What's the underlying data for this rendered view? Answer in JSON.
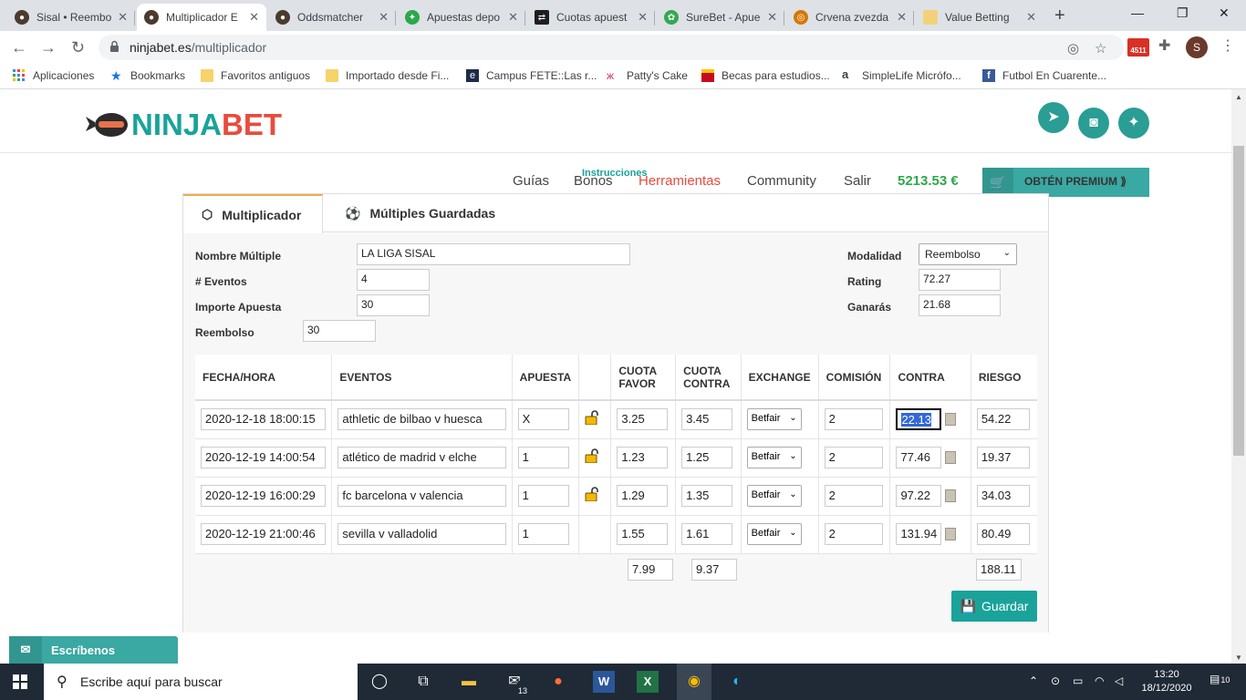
{
  "browser": {
    "tabs": [
      {
        "title": "Sisal • Reembo",
        "color": "#b5121b"
      },
      {
        "title": "Multiplicador E",
        "color": "#4a3b2d",
        "active": true
      },
      {
        "title": "Oddsmatcher",
        "color": "#4a3b2d"
      },
      {
        "title": "Apuestas depo",
        "color": "#2ba84a"
      },
      {
        "title": "Cuotas apuest",
        "color": "#1e1e1e"
      },
      {
        "title": "SureBet - Apue",
        "color": "#35a853"
      },
      {
        "title": "Crvena zvezda",
        "color": "#d47800"
      },
      {
        "title": "Value Betting",
        "color": "#f1d27a"
      }
    ],
    "url_host": "ninjabet.es",
    "url_path": "/multiplicador",
    "gmail_count": "4511",
    "avatar_letter": "S",
    "bookmarks": [
      {
        "label": "Aplicaciones",
        "icon": "apps-grid-icon"
      },
      {
        "label": "Bookmarks",
        "icon": "star-icon"
      },
      {
        "label": "Favoritos antiguos",
        "icon": "folder-icon"
      },
      {
        "label": "Importado desde Fi...",
        "icon": "folder-icon"
      },
      {
        "label": "Campus FETE::Las r...",
        "icon": "campus-icon"
      },
      {
        "label": "Patty's Cake",
        "icon": "butterfly-icon"
      },
      {
        "label": "Becas para estudios...",
        "icon": "spain-icon"
      },
      {
        "label": "SimpleLife Micrófo...",
        "icon": "amazon-icon"
      },
      {
        "label": "Futbol En Cuarente...",
        "icon": "facebook-icon"
      }
    ]
  },
  "site": {
    "logo_ninja": "NINJA",
    "logo_bet": "BET",
    "nav": [
      "Guías",
      "Bonos",
      "Herramientas",
      "Community",
      "Salir"
    ],
    "instrucciones": "Instrucciones",
    "balance": "5213.53 €",
    "premium": "OBTÉN PREMIUM ⟫"
  },
  "panel": {
    "tabs": [
      "Multiplicador",
      "Múltiples Guardadas"
    ],
    "fields": {
      "nombre_label": "Nombre Múltiple",
      "nombre_value": "LA LIGA SISAL",
      "eventos_label": "# Eventos",
      "eventos_value": "4",
      "importe_label": "Importe Apuesta",
      "importe_value": "30",
      "reembolso_label": "Reembolso",
      "reembolso_value": "30",
      "modalidad_label": "Modalidad",
      "modalidad_value": "Reembolso",
      "rating_label": "Rating",
      "rating_value": "72.27",
      "ganaras_label": "Ganarás",
      "ganaras_value": "21.68"
    },
    "table": {
      "headers": [
        "FECHA/HORA",
        "EVENTOS",
        "APUESTA",
        "",
        "CUOTA FAVOR",
        "CUOTA CONTRA",
        "EXCHANGE",
        "COMISIÓN",
        "CONTRA",
        "RIESGO"
      ],
      "rows": [
        {
          "fecha": "2020-12-18 18:00:15",
          "evento": "athletic de bilbao v huesca",
          "apuesta": "X",
          "lock": true,
          "favor": "3.25",
          "contra_cuota": "3.45",
          "exchange": "Betfair",
          "comision": "2",
          "contra": "22.13",
          "selected": true,
          "riesgo": "54.22"
        },
        {
          "fecha": "2020-12-19 14:00:54",
          "evento": "atlético de madrid v elche",
          "apuesta": "1",
          "lock": true,
          "favor": "1.23",
          "contra_cuota": "1.25",
          "exchange": "Betfair",
          "comision": "2",
          "contra": "77.46",
          "riesgo": "19.37"
        },
        {
          "fecha": "2020-12-19 16:00:29",
          "evento": "fc barcelona v valencia",
          "apuesta": "1",
          "lock": true,
          "favor": "1.29",
          "contra_cuota": "1.35",
          "exchange": "Betfair",
          "comision": "2",
          "contra": "97.22",
          "riesgo": "34.03"
        },
        {
          "fecha": "2020-12-19 21:00:46",
          "evento": "sevilla v valladolid",
          "apuesta": "1",
          "lock": false,
          "favor": "1.55",
          "contra_cuota": "1.61",
          "exchange": "Betfair",
          "comision": "2",
          "contra": "131.94",
          "riesgo": "80.49"
        }
      ],
      "totals": {
        "favor": "7.99",
        "contra_cuota": "9.37",
        "riesgo": "188.11"
      }
    },
    "guardar": "Guardar"
  },
  "chat": "Escríbenos",
  "taskbar": {
    "search_placeholder": "Escribe aquí para buscar",
    "mail_badge": "13",
    "time": "13:20",
    "date": "18/12/2020",
    "notif_count": "10"
  },
  "colors": {
    "accent": "#1aa39a",
    "brand_red": "#e84c3d",
    "balance": "#2ea84a",
    "tab_accent": "#f0ad4e"
  }
}
